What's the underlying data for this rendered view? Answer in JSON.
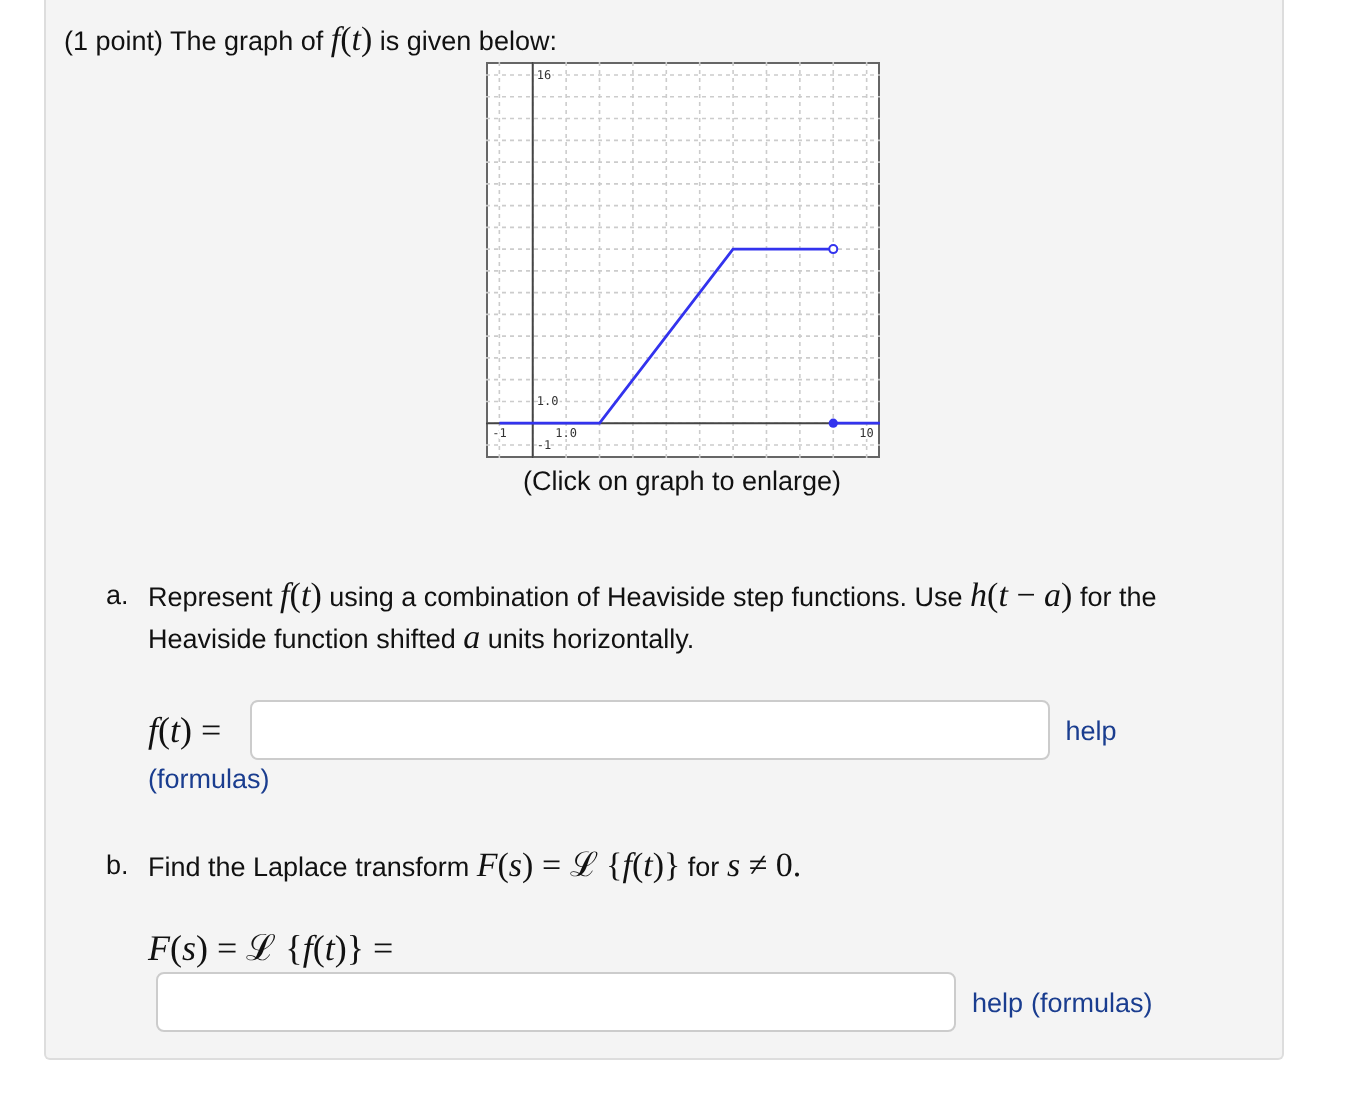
{
  "problem": {
    "intro": [
      {
        "kind": "text",
        "text": "(1 point) The graph of "
      },
      {
        "kind": "math",
        "text": "*f*(*t*)"
      },
      {
        "kind": "text",
        "text": " is given below:"
      }
    ],
    "graph": {
      "caption": "(Click on graph to enlarge)",
      "chart_data": {
        "type": "line",
        "grid": true,
        "xlim": [
          -1.4,
          10.4
        ],
        "ylim": [
          -1.6,
          16.6
        ],
        "xticks": [
          {
            "value": -1,
            "label": "-1"
          },
          {
            "value": 1,
            "label": "1.0"
          },
          {
            "value": 10,
            "label": "10"
          }
        ],
        "yticks": [
          {
            "value": -1,
            "label": "-1"
          },
          {
            "value": 1,
            "label": "1.0"
          },
          {
            "value": 16,
            "label": "16"
          }
        ],
        "series": [
          {
            "color": "#3333ee",
            "x": [
              -1,
              2,
              6,
              9
            ],
            "values": [
              0,
              0,
              8,
              8
            ]
          },
          {
            "color": "#3333ee",
            "x": [
              9,
              10.4
            ],
            "values": [
              0,
              0
            ]
          }
        ]
      }
    },
    "parts": [
      {
        "marker": "a.",
        "question": [
          {
            "kind": "text",
            "text": "Represent "
          },
          {
            "kind": "math",
            "text": "*f*(*t*)"
          },
          {
            "kind": "text",
            "text": " using a combination of Heaviside step functions. Use "
          },
          {
            "kind": "math",
            "text": "*h*(*t* − *a*)"
          },
          {
            "kind": "text",
            "text": " for the Heaviside function shifted "
          },
          {
            "kind": "math",
            "text": "*a*"
          },
          {
            "kind": "text",
            "text": " units horizontally."
          }
        ],
        "answer_label": "*f*(*t*) =",
        "links": [
          "help",
          "(formulas)"
        ]
      },
      {
        "marker": "b.",
        "question": [
          {
            "kind": "text",
            "text": "Find the Laplace transform "
          },
          {
            "kind": "math",
            "text": "*F*(*s*) = ℒ {*f*(*t*)}"
          },
          {
            "kind": "text",
            "text": " for "
          },
          {
            "kind": "math",
            "text": "*s* ≠ 0."
          }
        ],
        "answer_label": "*F*(*s*) = ℒ {*f*(*t*)} =",
        "links": [
          "help",
          "(formulas)"
        ]
      }
    ]
  }
}
